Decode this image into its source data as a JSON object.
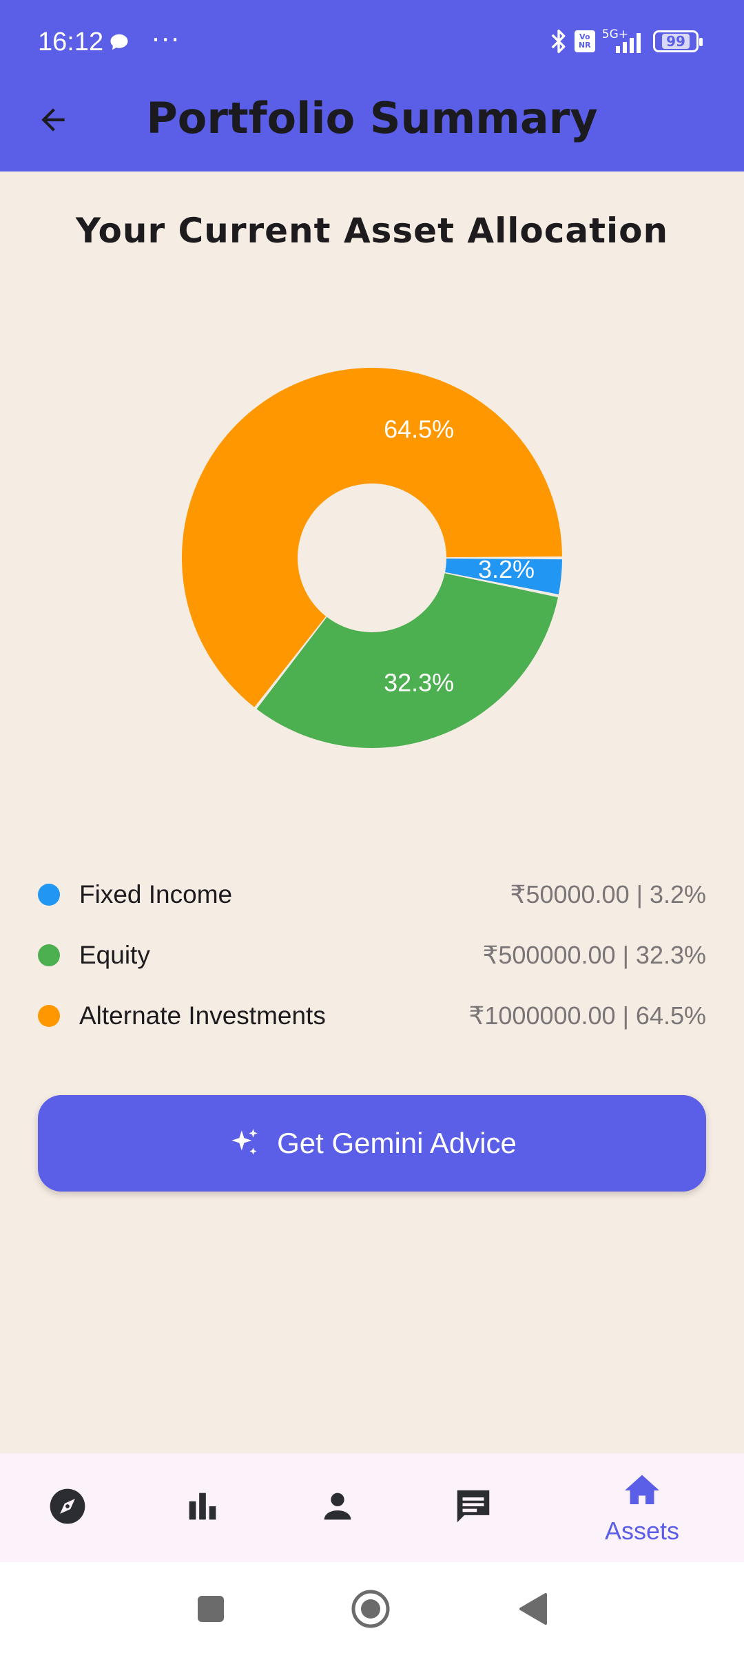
{
  "status_bar": {
    "time": "16:12",
    "more": "···",
    "network": "5G+",
    "volte": "Vo NR",
    "battery": "99",
    "icons": [
      "chat-bubble-icon",
      "bluetooth-icon",
      "volte-icon",
      "signal-icon",
      "battery-icon"
    ]
  },
  "app_bar": {
    "title": "Portfolio Summary",
    "back_icon": "arrow-left-icon"
  },
  "section_title": "Your Current Asset Allocation",
  "chart_data": {
    "type": "pie",
    "style": "donut",
    "categories": [
      "Fixed Income",
      "Equity",
      "Alternate Investments"
    ],
    "values": [
      3.2,
      32.3,
      64.5
    ],
    "labels": [
      "3.2%",
      "32.3%",
      "64.5%"
    ],
    "colors": [
      "#2196F3",
      "#4CAF50",
      "#FF9800"
    ]
  },
  "legend": [
    {
      "name": "Fixed Income",
      "value": "₹50000.00 | 3.2%",
      "color": "#2196F3"
    },
    {
      "name": "Equity",
      "value": "₹500000.00 | 32.3%",
      "color": "#4CAF50"
    },
    {
      "name": "Alternate Investments",
      "value": "₹1000000.00 | 64.5%",
      "color": "#FF9800"
    }
  ],
  "advice_button": {
    "label": "Get Gemini Advice",
    "icon": "sparkle-icon"
  },
  "bottom_nav": {
    "items": [
      {
        "icon": "compass-icon",
        "label": ""
      },
      {
        "icon": "bar-chart-icon",
        "label": ""
      },
      {
        "icon": "person-icon",
        "label": ""
      },
      {
        "icon": "message-icon",
        "label": ""
      },
      {
        "icon": "home-icon",
        "label": "Assets",
        "active": true
      }
    ]
  },
  "colors": {
    "primary": "#5B5EE6",
    "background": "#F5ECE3",
    "fixed_income": "#2196F3",
    "equity": "#4CAF50",
    "alternate": "#FF9800"
  }
}
